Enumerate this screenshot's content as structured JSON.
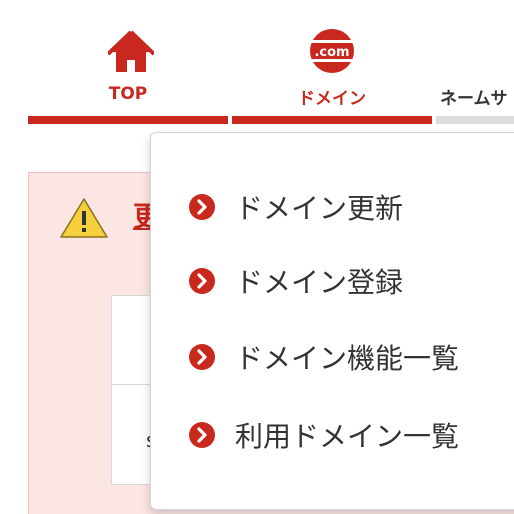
{
  "colors": {
    "brand_red": "#c8281d",
    "inactive_gray": "#dcdcdc",
    "warning_bg": "#fbe6e4",
    "warning_yellow": "#f5cf3c"
  },
  "nav": {
    "items": [
      {
        "label": "TOP",
        "icon": "home-icon",
        "active": true
      },
      {
        "label": "ドメイン",
        "icon": "dotcom-icon",
        "active": true,
        "icon_text": ".com"
      },
      {
        "label": "ネームサ",
        "icon": "",
        "active": false
      }
    ]
  },
  "warning": {
    "icon": "warning-icon",
    "title_visible": "更",
    "cell_visible": "s"
  },
  "dropdown": {
    "items": [
      {
        "label": "ドメイン更新",
        "icon": "chevron-right-circle-icon"
      },
      {
        "label": "ドメイン登録",
        "icon": "chevron-right-circle-icon"
      },
      {
        "label": "ドメイン機能一覧",
        "icon": "chevron-right-circle-icon"
      },
      {
        "label": "利用ドメイン一覧",
        "icon": "chevron-right-circle-icon"
      }
    ]
  }
}
